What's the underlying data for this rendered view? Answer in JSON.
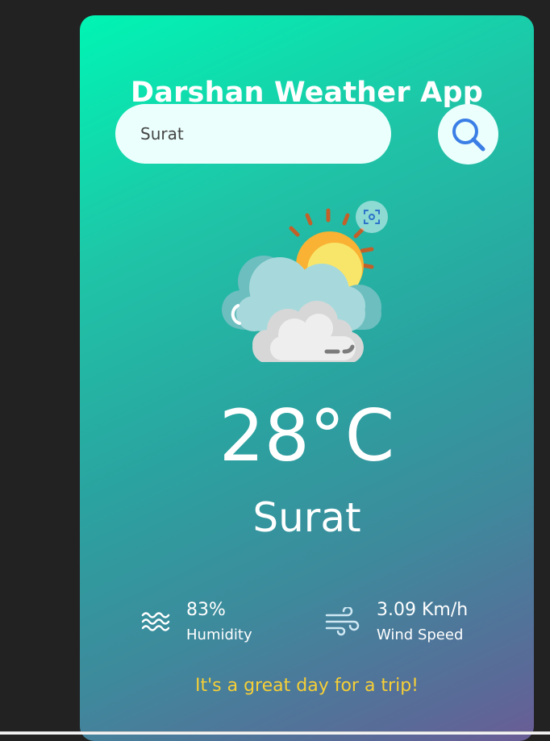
{
  "app": {
    "title": "Darshan Weather App"
  },
  "search": {
    "value": "Surat",
    "button_icon": "search-icon"
  },
  "weather": {
    "icon": "sun-cloud-icon",
    "temperature": "28°C",
    "city": "Surat"
  },
  "stats": {
    "humidity": {
      "value": "83%",
      "label": "Humidity",
      "icon": "humidity-waves-icon"
    },
    "wind": {
      "value": "3.09 Km/h",
      "label": "Wind Speed",
      "icon": "wind-icon"
    }
  },
  "message": "It's a great day for a trip!",
  "colors": {
    "accent": "#f6cf36",
    "gradient_start": "#00f5b4",
    "gradient_end": "#6a5c96",
    "search_bg": "#ebfffc",
    "search_icon": "#3a7ee6"
  }
}
